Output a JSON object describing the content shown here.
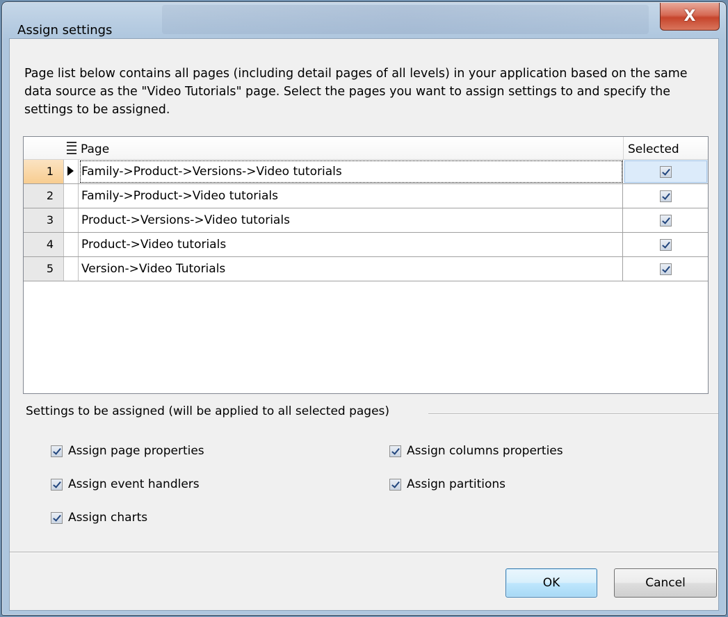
{
  "window": {
    "title": "Assign settings",
    "close_glyph": "X"
  },
  "intro_text": "Page list below contains all pages (including detail pages of all levels) in your application based on the same data source as the \"Video Tutorials\" page. Select the pages you want to assign settings to and specify the settings to be assigned.",
  "grid": {
    "columns": [
      "Page",
      "Selected"
    ],
    "rows": [
      {
        "num": "1",
        "page": "Family->Product->Versions->Video tutorials",
        "selected": true
      },
      {
        "num": "2",
        "page": "Family->Product->Video tutorials",
        "selected": true
      },
      {
        "num": "3",
        "page": "Product->Versions->Video tutorials",
        "selected": true
      },
      {
        "num": "4",
        "page": "Product->Video tutorials",
        "selected": true
      },
      {
        "num": "5",
        "page": "Version->Video Tutorials",
        "selected": true
      }
    ]
  },
  "settings": {
    "group_label": "Settings to be assigned (will be applied to all selected pages)",
    "options": {
      "page_properties": {
        "label": "Assign page properties",
        "checked": true
      },
      "event_handlers": {
        "label": "Assign event handlers",
        "checked": true
      },
      "charts": {
        "label": "Assign charts",
        "checked": true
      },
      "columns_properties": {
        "label": "Assign columns properties",
        "checked": true
      },
      "partitions": {
        "label": "Assign partitions",
        "checked": true
      }
    }
  },
  "buttons": {
    "ok": "OK",
    "cancel": "Cancel"
  }
}
